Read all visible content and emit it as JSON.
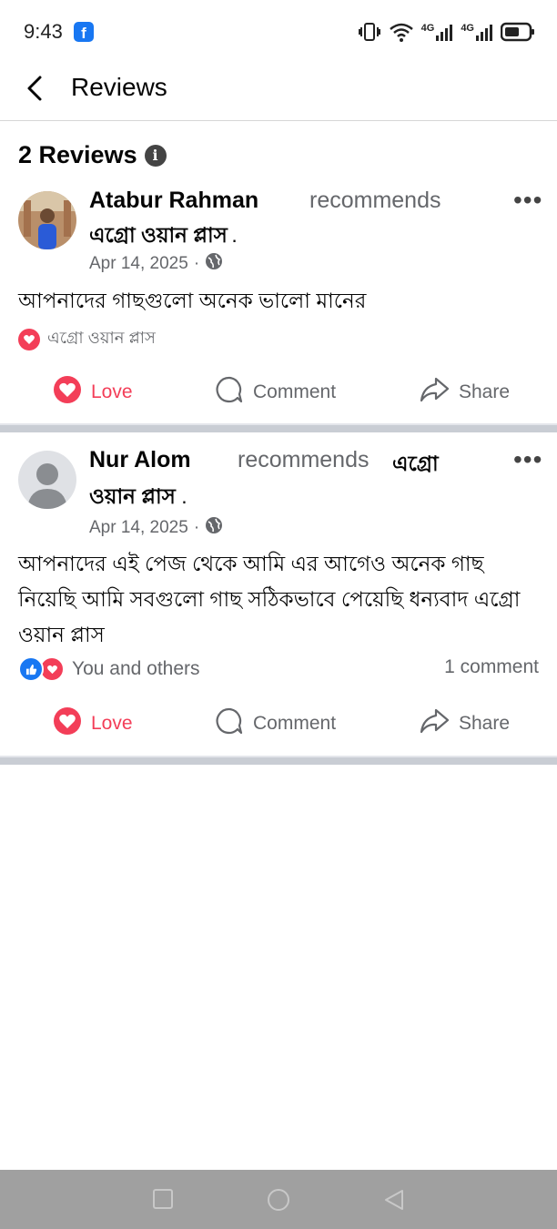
{
  "status_bar": {
    "time": "9:43",
    "app_icon": "facebook-icon",
    "network_1": "4G",
    "network_2": "4G",
    "icons": [
      "vibrate-icon",
      "wifi-icon",
      "signal-icon",
      "signal-icon",
      "battery-icon"
    ]
  },
  "header": {
    "title": "Reviews",
    "back_icon": "back-arrow-icon"
  },
  "summary": {
    "count_label": "2 Reviews",
    "info_icon": "info-icon"
  },
  "reviews": [
    {
      "author": "Atabur Rahman",
      "action": "recommends",
      "page": "এগ্রো ওয়ান প্লাস",
      "page_suffix": ".",
      "date": "Apr 14, 2025",
      "separator": "·",
      "privacy_icon": "globe-icon",
      "text": "আপনাদের গাছগুলো অনেক ভালো মানের",
      "reaction_label": "এগ্রো ওয়ান প্লাস",
      "reactions": [
        "love"
      ],
      "comment_count": "",
      "actions": {
        "love": "Love",
        "comment": "Comment",
        "share": "Share"
      }
    },
    {
      "author": "Nur Alom",
      "action": "recommends",
      "page": "এগ্রো ওয়ান প্লাস",
      "page_suffix": ".",
      "date": "Apr 14, 2025",
      "separator": "·",
      "privacy_icon": "globe-icon",
      "text": "আপনাদের এই পেজ থেকে আমি এর আগেও অনেক গাছ নিয়েছি আমি সবগুলো গাছ সঠিকভাবে পেয়েছি ধন্যবাদ এগ্রো ওয়ান প্লাস",
      "reaction_label": "You and others",
      "reactions": [
        "like",
        "love"
      ],
      "comment_count": "1 comment",
      "actions": {
        "love": "Love",
        "comment": "Comment",
        "share": "Share"
      }
    }
  ],
  "colors": {
    "love": "#f33e58",
    "like": "#1877f2",
    "muted": "#65676b",
    "divider": "#c9cdd4",
    "nav_bar": "#a0a0a0"
  },
  "nav_bar": {
    "icons": [
      "recent-apps-icon",
      "home-icon",
      "back-icon"
    ]
  }
}
